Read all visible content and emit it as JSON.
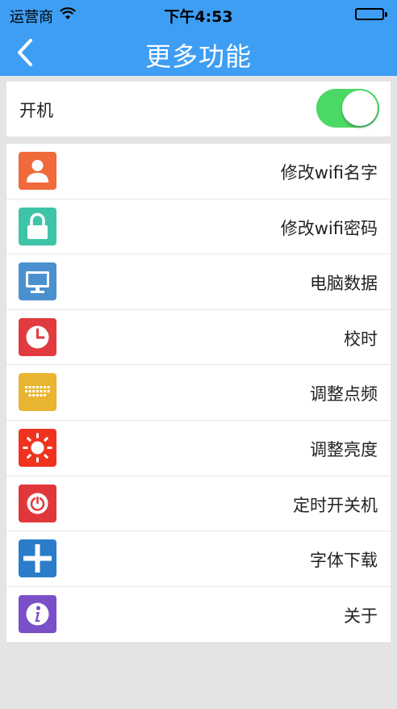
{
  "status_bar": {
    "carrier": "运营商",
    "time": "下午4:53"
  },
  "nav": {
    "title": "更多功能"
  },
  "power": {
    "label": "开机",
    "enabled": true
  },
  "colors": {
    "nav_blue": "#3e9ef4",
    "toggle_green": "#4cd864"
  },
  "menu": [
    {
      "label": "修改wifi名字",
      "icon": "user-icon",
      "color": "#f06a3b"
    },
    {
      "label": "修改wifi密码",
      "icon": "lock-icon",
      "color": "#3fc4a8"
    },
    {
      "label": "电脑数据",
      "icon": "monitor-icon",
      "color": "#4a90cf"
    },
    {
      "label": "校时",
      "icon": "clock-icon",
      "color": "#e23b3f"
    },
    {
      "label": "调整点频",
      "icon": "keyboard-icon",
      "color": "#e9b530"
    },
    {
      "label": "调整亮度",
      "icon": "sun-icon",
      "color": "#f0331f"
    },
    {
      "label": "定时开关机",
      "icon": "power-icon",
      "color": "#e0383a"
    },
    {
      "label": "字体下载",
      "icon": "plus-icon",
      "color": "#2b7cc9"
    },
    {
      "label": "关于",
      "icon": "info-icon",
      "color": "#7a4fc8"
    }
  ]
}
